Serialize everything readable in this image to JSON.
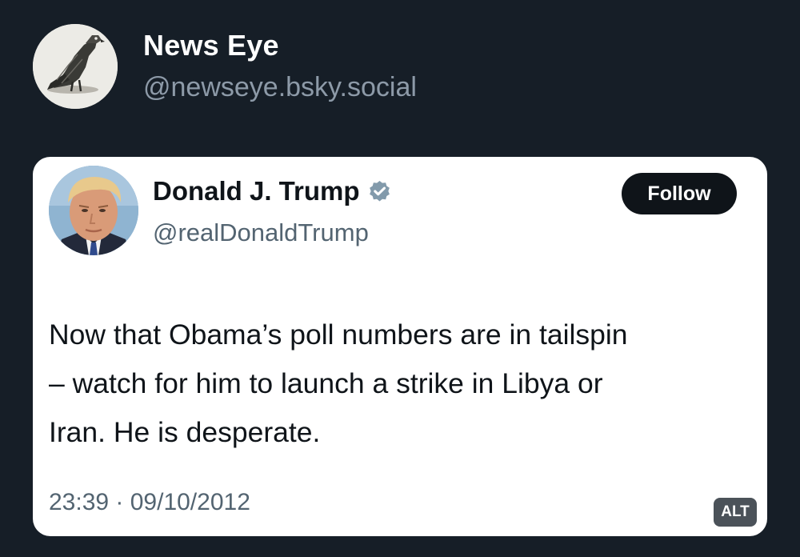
{
  "poster": {
    "avatar_icon": "eagle-illustration-avatar",
    "display_name": "News Eye",
    "handle": "@newseye.bsky.social"
  },
  "embedded_tweet": {
    "avatar_icon": "profile-photo-avatar",
    "display_name": "Donald J. Trump",
    "verified_icon": "verified-badge-icon",
    "handle": "@realDonaldTrump",
    "follow_label": "Follow",
    "text": "Now that Obama’s poll numbers are in tailspin\n– watch for him to launch a strike in Libya or\nIran.  He is desperate.",
    "timestamp": "23:39 · 09/10/2012"
  },
  "image_badge": {
    "alt_label": "ALT"
  },
  "colors": {
    "page_background": "#161e27",
    "card_background": "#ffffff",
    "poster_name": "#ffffff",
    "poster_handle": "#8d9aa8",
    "tweet_text": "#0f1419",
    "secondary_text": "#536471",
    "follow_button": "#0f1419",
    "verified_badge": "#829aab",
    "alt_badge": "#4b5259"
  }
}
